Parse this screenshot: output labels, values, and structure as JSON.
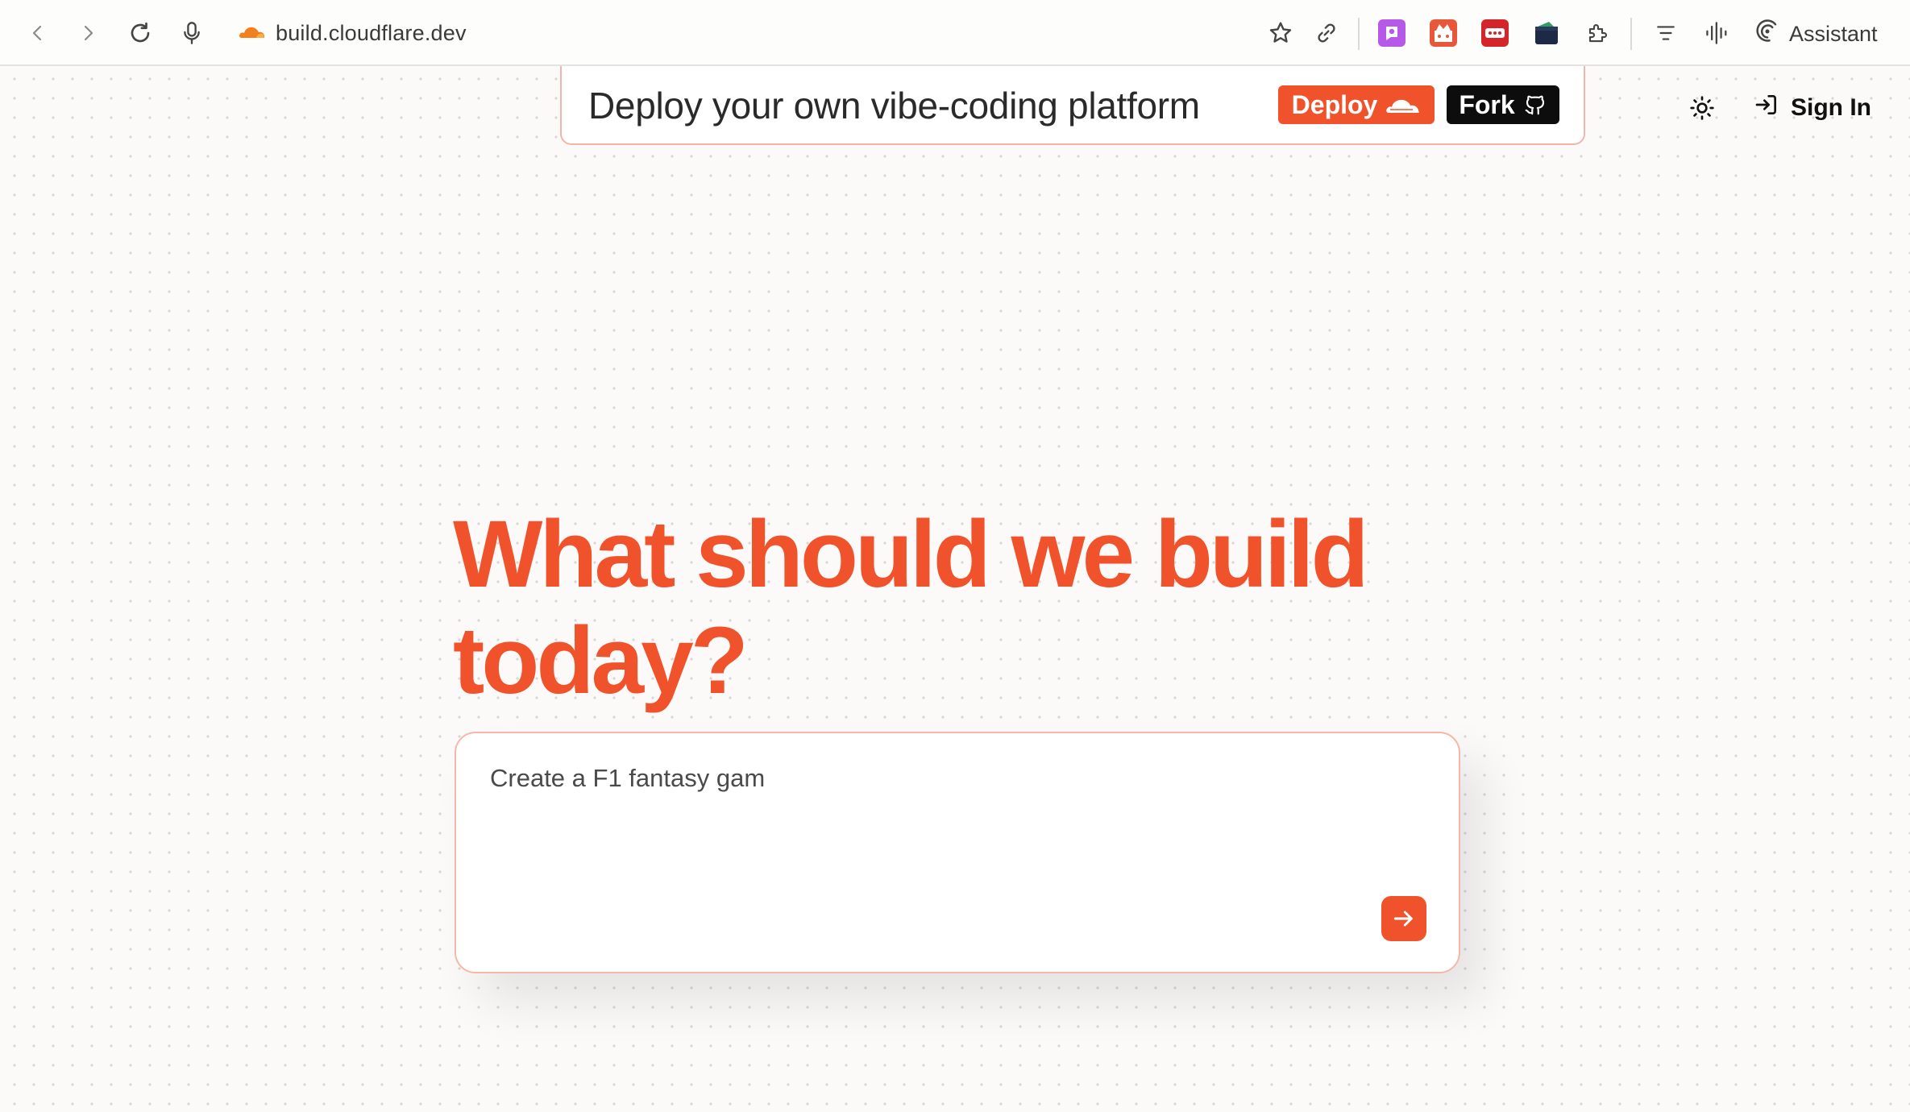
{
  "browser": {
    "url": "build.cloudflare.dev",
    "assistant_label": "Assistant",
    "icons": [
      "back-icon",
      "forward-icon",
      "reload-icon",
      "microphone-icon",
      "cloudflare-favicon",
      "bookmark-star-icon",
      "share-link-icon",
      "extensions-icon",
      "reading-list-icon",
      "audio-waveform-icon",
      "assistant-icon"
    ]
  },
  "banner": {
    "text": "Deploy your own vibe-coding platform",
    "deploy_label": "Deploy",
    "fork_label": "Fork"
  },
  "header": {
    "signin_label": "Sign In"
  },
  "hero": {
    "headline": "What should we build today?"
  },
  "prompt": {
    "value": "Create a F1 fantasy gam"
  },
  "colors": {
    "accent": "#f0532c",
    "fork_bg": "#0d0d0d",
    "border": "#f4b8aa"
  }
}
